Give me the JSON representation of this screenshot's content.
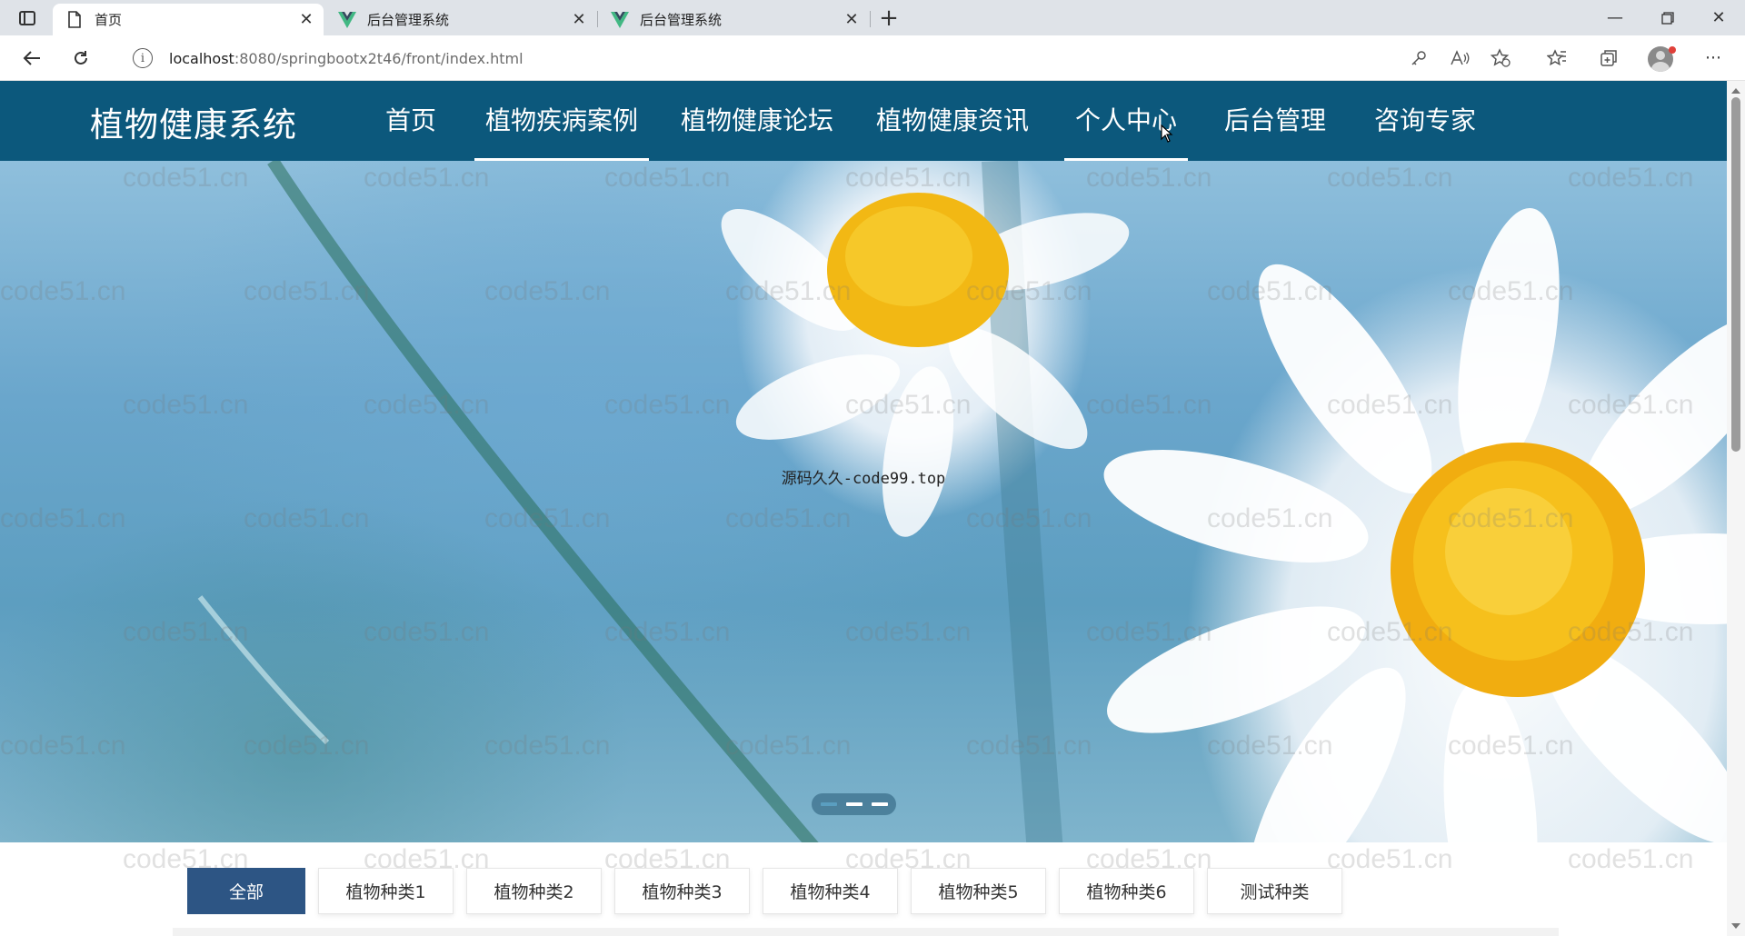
{
  "browser": {
    "tabs": [
      {
        "title": "首页",
        "icon": "page-icon",
        "active": true
      },
      {
        "title": "后台管理系统",
        "icon": "vue-logo-icon",
        "active": false
      },
      {
        "title": "后台管理系统",
        "icon": "vue-logo-icon",
        "active": false
      }
    ],
    "url": {
      "host": "localhost",
      "path": ":8080/springbootx2t46/front/index.html"
    }
  },
  "header": {
    "site_title": "植物健康系统",
    "nav": [
      {
        "label": "首页",
        "underlined": false
      },
      {
        "label": "植物疾病案例",
        "underlined": true
      },
      {
        "label": "植物健康论坛",
        "underlined": false
      },
      {
        "label": "植物健康资讯",
        "underlined": false
      },
      {
        "label": "个人中心",
        "underlined": true
      },
      {
        "label": "后台管理",
        "underlined": false
      },
      {
        "label": "咨询专家",
        "underlined": false
      }
    ],
    "colors": {
      "header_bg": "#0c587c",
      "text": "#ffffff"
    }
  },
  "banner": {
    "caption": "源码久久-code99.top",
    "slides_total": 3,
    "current_slide": 1
  },
  "watermark": {
    "text": "code51.cn"
  },
  "categories": {
    "items": [
      "全部",
      "植物种类1",
      "植物种类2",
      "植物种类3",
      "植物种类4",
      "植物种类5",
      "植物种类6",
      "测试种类"
    ],
    "selected": "全部",
    "colors": {
      "selected_bg": "#2d5584"
    }
  }
}
